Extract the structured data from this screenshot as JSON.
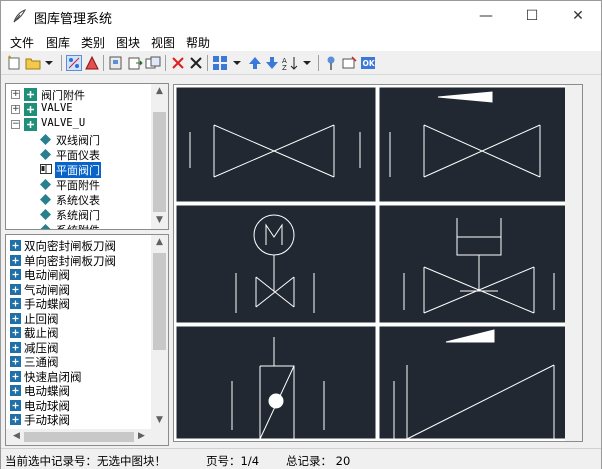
{
  "window": {
    "title": "图库管理系统",
    "minimize": "—",
    "maximize": "☐",
    "close": "✕"
  },
  "menu": [
    "文件",
    "图库",
    "类别",
    "图块",
    "视图",
    "帮助"
  ],
  "tree": {
    "nodes": [
      "阀门附件",
      "VALVE",
      "VALVE_U"
    ],
    "children": [
      "双线阀门",
      "平面仪表",
      "平面阀门",
      "平面附件",
      "系统仪表",
      "系统阀门",
      "系统附件"
    ],
    "selected": "平面阀门",
    "expanded": "VALVE_U"
  },
  "list": {
    "items": [
      "双向密封闸板刀阀",
      "单向密封闸板刀阀",
      "电动闸阀",
      "气动闸阀",
      "手动蝶阀",
      "止回阀",
      "截止阀",
      "减压阀",
      "三通阀",
      "快速启闭阀",
      "电动蝶阀",
      "电动球阀",
      "手动球阀"
    ]
  },
  "status": {
    "record": "当前选中记录号：无选中图块！",
    "page": "页号：1/4",
    "total": "总记录： 20"
  },
  "colors": {
    "canvas_bg": "#222831",
    "stroke": "#ffffff",
    "selection": "#0a64c8"
  }
}
